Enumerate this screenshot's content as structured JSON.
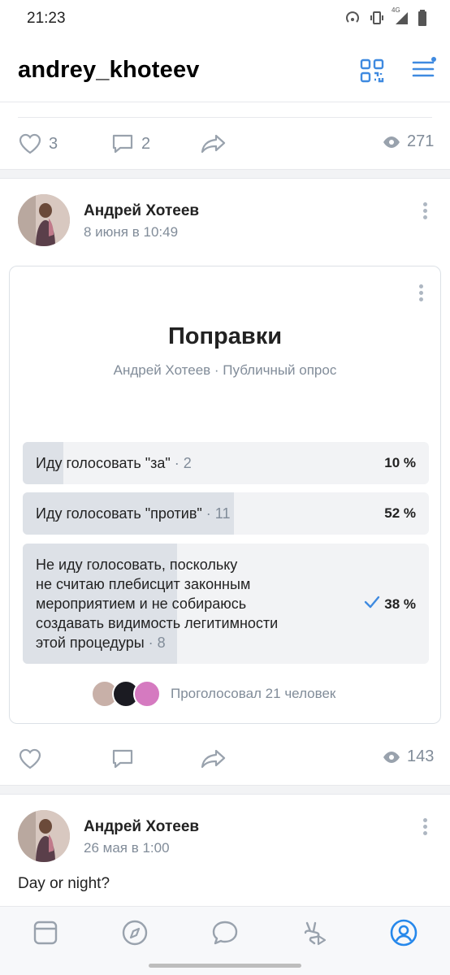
{
  "status": {
    "time": "21:23",
    "network": "4G"
  },
  "header": {
    "title": "andrey_khoteev"
  },
  "icons": {
    "qr": "qr-code-icon",
    "menu": "hamburger-menu-icon",
    "like": "heart-icon",
    "comment": "comment-icon",
    "share": "share-icon",
    "views": "eye-icon"
  },
  "colors": {
    "accent": "#3f8ae0",
    "muted": "#818c99",
    "icon": "#99a2ad"
  },
  "post1": {
    "likes": "3",
    "comments": "2",
    "views": "271"
  },
  "post2": {
    "author": "Андрей Хотеев",
    "date": "8 июня в 10:49",
    "poll": {
      "title": "Поправки",
      "subtitle": "Андрей Хотеев · Публичный опрос",
      "options": [
        {
          "text": "Иду голосовать \"за\"",
          "count": " · 2",
          "percent": "10 %",
          "share": 0.1,
          "voted": false
        },
        {
          "text": "Иду голосовать \"против\"",
          "count": " · 11",
          "percent": "52 %",
          "share": 0.52,
          "voted": false
        },
        {
          "lines": [
            "Не иду голосовать, поскольку",
            "не считаю плебисцит законным",
            "мероприятием и не собираюсь",
            "создавать видимость легитимности",
            "этой процедуры"
          ],
          "count": " · 8",
          "percent": "38 %",
          "share": 0.38,
          "voted": true
        }
      ],
      "voters_text": "Проголосовал 21 человек"
    },
    "views": "143"
  },
  "post3": {
    "author": "Андрей Хотеев",
    "date": "26 мая в 1:00",
    "text": "Day or night?"
  },
  "tabbar": {
    "items": [
      "news-tab",
      "discover-tab",
      "messages-tab",
      "clips-tab",
      "profile-tab"
    ],
    "active": "profile-tab"
  }
}
